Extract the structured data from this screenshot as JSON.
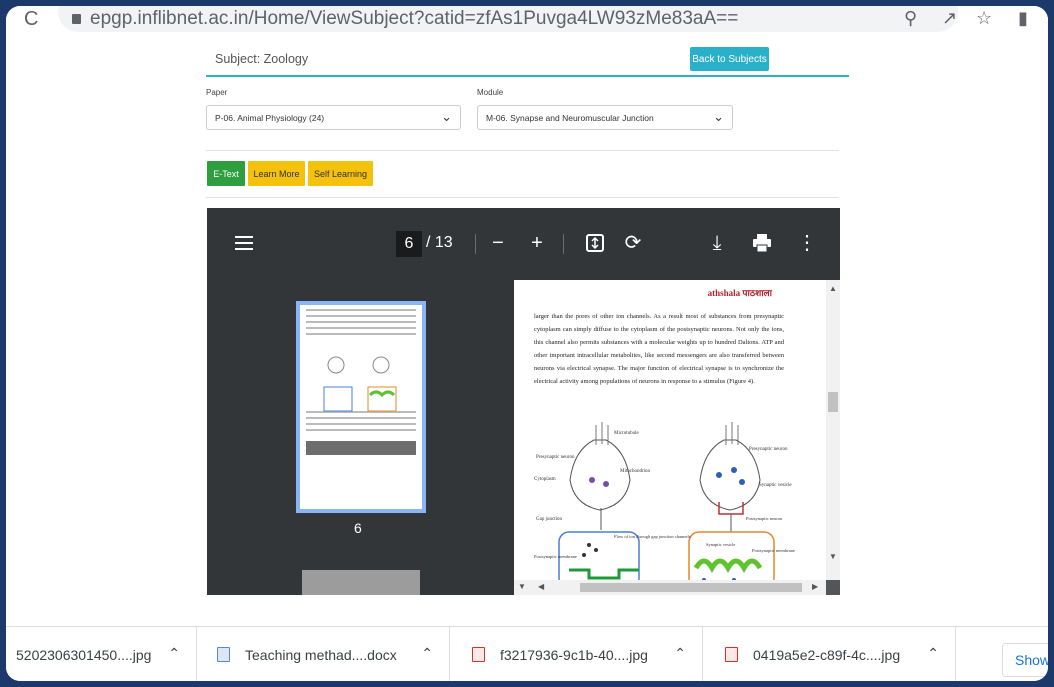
{
  "browser": {
    "url": "epgp.inflibnet.ac.in/Home/ViewSubject?catid=zfAs1Puvga4LW93zMe83aA=="
  },
  "page": {
    "subject_label": "Subject: Zoology",
    "back_button": "Back to Subjects",
    "paper_label": "Paper",
    "paper_value": "P-06. Animal Physiology (24)",
    "module_label": "Module",
    "module_value": "M-06. Synapse and Neuromuscular Junction",
    "tabs": [
      {
        "label": "E-Text",
        "color": "#2e9e3e"
      },
      {
        "label": "Learn More",
        "color": "#f4c20d"
      },
      {
        "label": "Self Learning",
        "color": "#f4c20d"
      }
    ]
  },
  "viewer": {
    "current_page": "6",
    "total_pages": "/ 13",
    "thumbnail_label": "6",
    "logo_text": "athshala पाठशाला",
    "body_text": "larger than the pores of other ion channels. As a result most of substances from presynaptic cytoplasm can simply diffuse to the cytoplasm of the postsynaptic neurons. Not only the ions, this channel also permits substances with a molecular weights up to hundred Daltons. ATP and other important intracellular metabolites, like second messengers are also transferred between neurons via electrical synapse. The major function of electrical synapse is to synchronize the electrical activity among populations of neurons in response to a stimulus (Figure 4).",
    "figure_labels": {
      "microtubule": "Microtubule",
      "presynaptic_neuron": "Presynaptic neuron",
      "cytoplasm": "Cytoplasm",
      "mitochondrion": "Mitochondrion",
      "gap_junction": "Gap junction",
      "flow": "Flow of ion through gap junction channels",
      "postsynaptic_membrane": "Postsynaptic membrane",
      "presynaptic_neuron_2": "Presynaptic neuron",
      "synaptic_vesicle": "Synaptic vesicle",
      "postsynaptic_neuron": "Postsynaptic neuron",
      "synaptic_vesicle_2": "Synaptic vesicle",
      "postsynaptic_membrane_2": "Postsynaptic membrane"
    }
  },
  "downloads": [
    {
      "name": "5202306301450....jpg",
      "type": "image"
    },
    {
      "name": "Teaching methad....docx",
      "type": "doc"
    },
    {
      "name": "f3217936-9c1b-40....jpg",
      "type": "image"
    },
    {
      "name": "0419a5e2-c89f-4c....jpg",
      "type": "image"
    }
  ],
  "show_all": "Show",
  "colors": {
    "accent": "#2ab0c8",
    "frame": "#1b3a6b",
    "viewer_bar": "#323639"
  }
}
